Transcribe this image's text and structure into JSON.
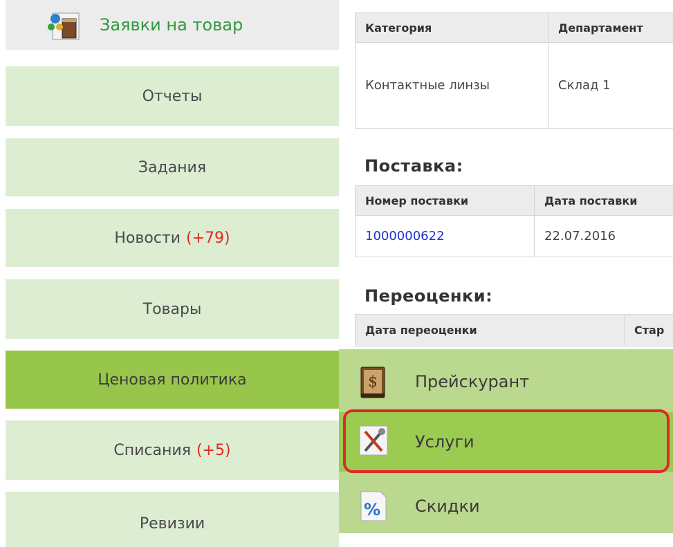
{
  "sidebar": {
    "top_item": {
      "label": "Заявки на товар",
      "icon": "orders-icon"
    },
    "items": [
      {
        "label": "Отчеты",
        "count": ""
      },
      {
        "label": "Задания",
        "count": ""
      },
      {
        "label": "Новости",
        "count": "(+79)"
      },
      {
        "label": "Товары",
        "count": ""
      },
      {
        "label": "Ценовая политика",
        "count": ""
      },
      {
        "label": "Списания",
        "count": "(+5)"
      },
      {
        "label": "Ревизии",
        "count": ""
      }
    ]
  },
  "main": {
    "category_table": {
      "headers": [
        "Категория",
        "Департамент"
      ],
      "row": [
        "Контактные линзы",
        "Склад 1"
      ]
    },
    "delivery": {
      "title": "Поставка:",
      "headers": [
        "Номер поставки",
        "Дата поставки"
      ],
      "row": [
        "1000000622",
        "22.07.2016"
      ]
    },
    "revaluations": {
      "title": "Переоценки:",
      "headers": [
        "Дата переоценки",
        "Стар"
      ]
    }
  },
  "submenu": {
    "items": [
      {
        "label": "Прейскурант",
        "icon": "price-list-book-icon"
      },
      {
        "label": "Услуги",
        "icon": "services-tools-icon"
      },
      {
        "label": "Скидки",
        "icon": "discount-percent-icon"
      }
    ]
  },
  "colors": {
    "nav_bg": "#dcedd2",
    "nav_active": "#97c64a",
    "submenu_bg": "#bbd98e",
    "submenu_highlight": "#9ccb52",
    "highlight_border": "#e2262a",
    "count_red": "#e02a1c",
    "link_blue": "#2233cc"
  }
}
